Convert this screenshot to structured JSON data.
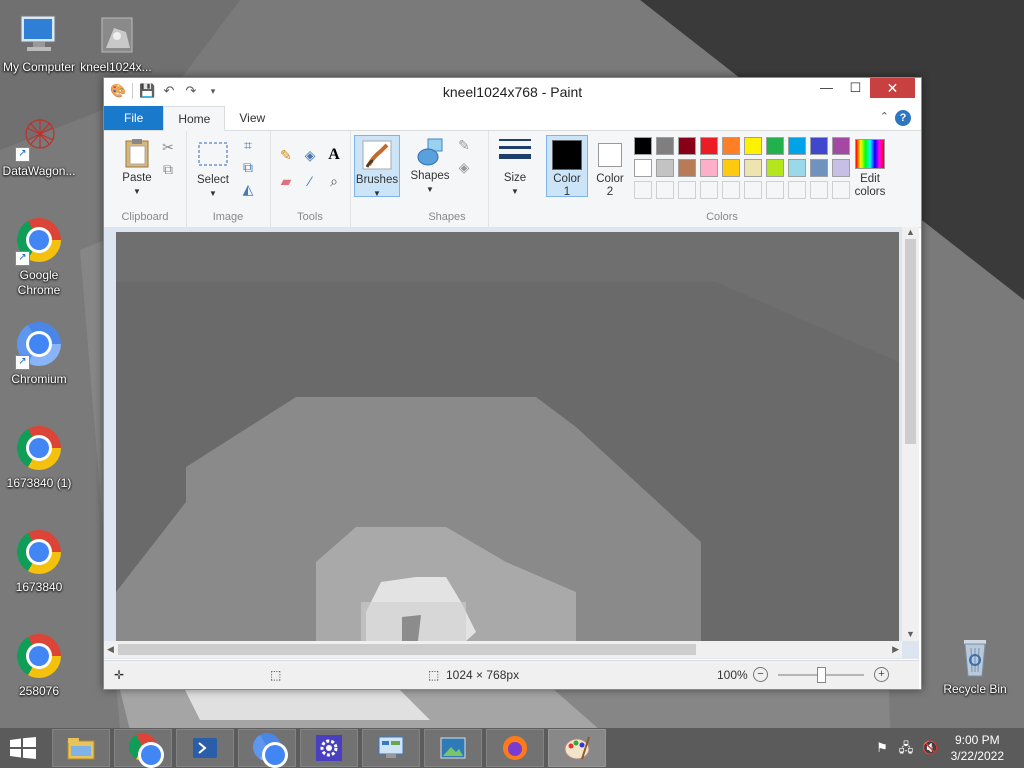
{
  "desktop": {
    "icons": [
      {
        "label": "My Computer"
      },
      {
        "label": "kneel1024x..."
      },
      {
        "label": "DataWagon..."
      },
      {
        "label": "Google Chrome"
      },
      {
        "label": "Chromium"
      },
      {
        "label": "1673840 (1)"
      },
      {
        "label": "1673840"
      },
      {
        "label": "258076"
      },
      {
        "label": "Recycle Bin"
      }
    ]
  },
  "window": {
    "title": "kneel1024x768 - Paint",
    "tabs": {
      "file": "File",
      "home": "Home",
      "view": "View"
    },
    "ribbon": {
      "clipboard": {
        "paste": "Paste",
        "label": "Clipboard"
      },
      "image": {
        "select": "Select",
        "label": "Image"
      },
      "tools": {
        "label": "Tools",
        "text_glyph": "A"
      },
      "brushes": {
        "label": "Brushes"
      },
      "shapes": {
        "shapes": "Shapes",
        "label": "Shapes"
      },
      "size": {
        "label": "Size"
      },
      "colors": {
        "color1": "Color 1",
        "color1_num": "1",
        "color1_text": "Color",
        "color2_text": "Color",
        "color2_num": "2",
        "edit_colors_line1": "Edit",
        "edit_colors_line2": "colors",
        "label": "Colors",
        "color1_value": "#000000",
        "color2_value": "#ffffff",
        "palette_row1": [
          "#000000",
          "#7f7f7f",
          "#880015",
          "#ed1c24",
          "#ff7f27",
          "#fff200",
          "#22b14c",
          "#00a2e8",
          "#3f48cc",
          "#a349a4"
        ],
        "palette_row2": [
          "#ffffff",
          "#c3c3c3",
          "#b97a57",
          "#ffaec9",
          "#ffc90e",
          "#efe4b0",
          "#b5e61d",
          "#99d9ea",
          "#7092be",
          "#c8bfe7"
        ]
      }
    },
    "status": {
      "dimensions": "1024 × 768px",
      "zoom": "100%"
    }
  },
  "taskbar": {
    "time": "9:00 PM",
    "date": "3/22/2022"
  }
}
